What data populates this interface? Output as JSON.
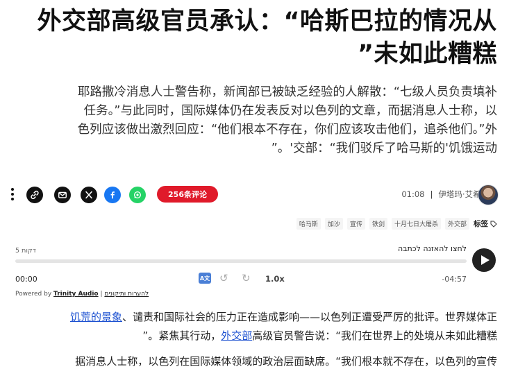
{
  "article": {
    "headline_line1": "外交部高级官员承认：“哈斯巴拉的情况从",
    "headline_line2": "”未如此糟糕",
    "subtitle_line1": "耶路撒冷消息人士警告称，新闻部已被缺乏经验的人解散：“七级人员负责填补",
    "subtitle_line2": "任务。”与此同时，国际媒体仍在发表反对以色列的文章，而据消息人士称，以",
    "subtitle_line3": "色列应该做出激烈回应：“他们根本不存在，你们应该攻击他们，追杀他们。”外",
    "subtitle_line4": "”。'交部：“我们驳斥了哈马斯的'饥饿运动"
  },
  "share_bar": {
    "icons": [
      "link-icon",
      "email-icon",
      "x-icon",
      "facebook-icon",
      "whatsapp-icon"
    ],
    "comments_label": "256条评论",
    "time": "01:08",
    "author": "伊塔玛·艾希纳"
  },
  "tags": {
    "label": "标签",
    "items": [
      "外交部",
      "十月七日大屠杀",
      "铁剑",
      "宣传",
      "加沙",
      "哈马斯"
    ]
  },
  "audio_player": {
    "listen_label": "לחצו להאזנה לכתבה",
    "duration_label": "5 דקות",
    "current_time": "00:00",
    "remaining_time": "-04:57",
    "speed": "1.0x",
    "translate_label": "A文",
    "progress": 0,
    "powered_prefix": "Powered by",
    "powered_brand": "Trinity Audio",
    "powered_separator": "|",
    "feedback_link": "להערות ותיקונים"
  },
  "body": {
    "para1_link1": "饥荒的景象",
    "para1_line1_rest": "、谴责和国际社会的压力正在造成影响——以色列正遭受严厉的批评。世界媒体正",
    "para1_line2_prefix": "”。紧焦其行动，",
    "para1_link2": "外交部",
    "para1_line2_rest": "高级官员警告说：“我们在世界上的处境从未如此糟糕",
    "para2_line1": "据消息人士称，以色列在国际媒体领域的政治层面缺席。“我们根本就不存在，以色列的宣传"
  },
  "colors": {
    "comments_bg": "#e01a2a",
    "link": "#1a4fd0",
    "x": "#111111",
    "facebook": "#1877f2",
    "whatsapp": "#25d366"
  }
}
